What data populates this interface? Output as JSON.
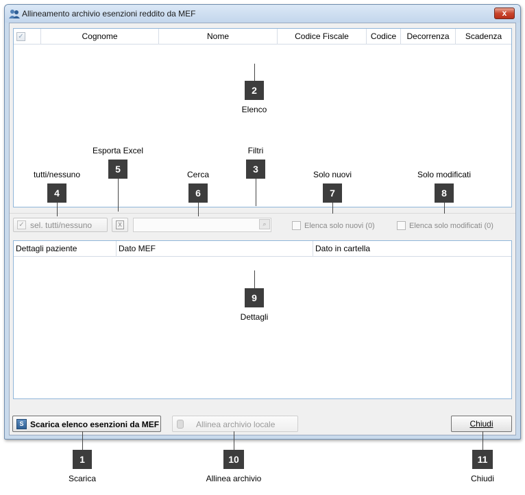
{
  "window": {
    "title": "Allineamento archivio esenzioni reddito da MEF",
    "close_label": "x"
  },
  "list_grid": {
    "columns": [
      "Cognome",
      "Nome",
      "Codice Fiscale",
      "Codice",
      "Decorrenza",
      "Scadenza"
    ]
  },
  "toolbar": {
    "select_all_label": "sel. tutti/nessuno",
    "search_value": "",
    "only_new_label": "Elenca solo nuovi (0)",
    "only_modified_label": "Elenca solo modificati (0)"
  },
  "details_grid": {
    "columns": [
      "Dettagli paziente",
      "Dato MEF",
      "Dato in cartella"
    ]
  },
  "buttons": {
    "download_label": "Scarica elenco esenzioni da MEF",
    "align_label": "Allinea archivio locale",
    "close_label": "Chiudi"
  },
  "callouts": [
    {
      "number": "1",
      "label": "Scarica"
    },
    {
      "number": "2",
      "label": "Elenco"
    },
    {
      "number": "3",
      "label": "Filtri"
    },
    {
      "number": "4",
      "label": "tutti/nessuno"
    },
    {
      "number": "5",
      "label": "Esporta Excel"
    },
    {
      "number": "6",
      "label": "Cerca"
    },
    {
      "number": "7",
      "label": "Solo nuovi"
    },
    {
      "number": "8",
      "label": "Solo modificati"
    },
    {
      "number": "9",
      "label": "Dettagli"
    },
    {
      "number": "10",
      "label": "Allinea archivio"
    },
    {
      "number": "11",
      "label": "Chiudi"
    }
  ]
}
